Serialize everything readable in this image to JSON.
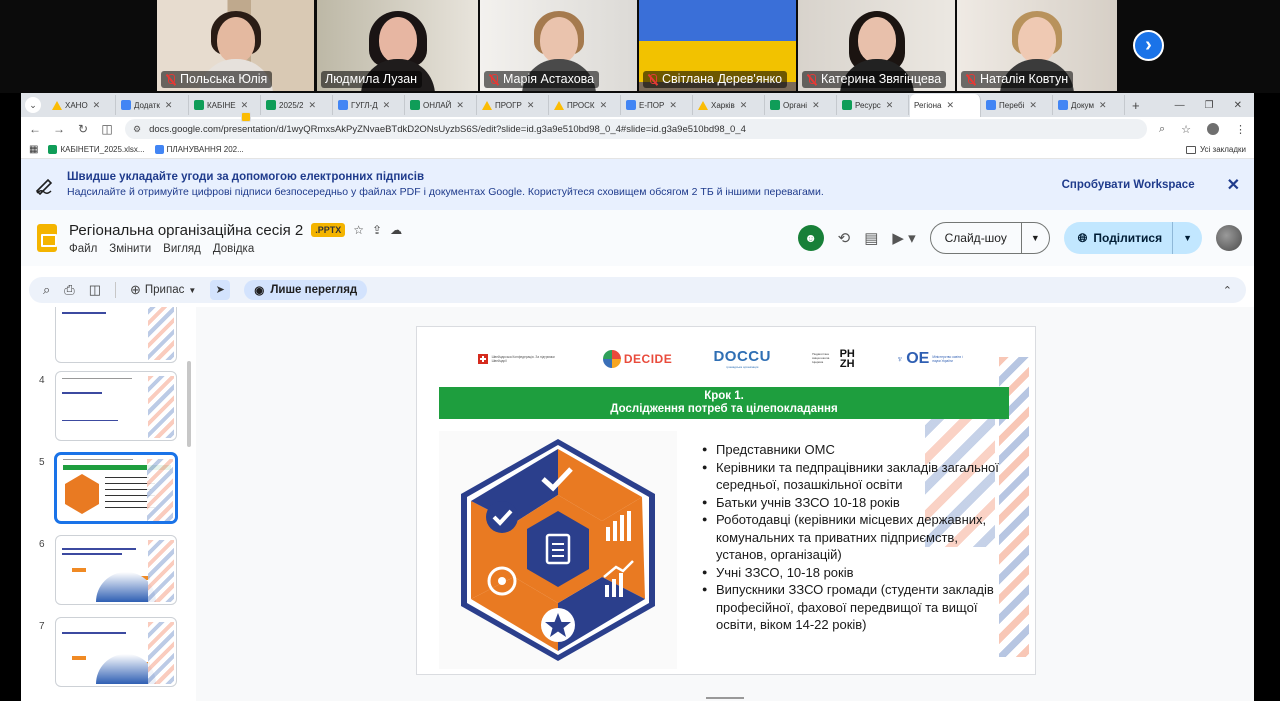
{
  "conference": {
    "participants": [
      {
        "name": "Польська Юлія",
        "muted": true
      },
      {
        "name": "Людмила Лузан",
        "muted": false
      },
      {
        "name": "Марія Астахова",
        "muted": true
      },
      {
        "name": "Світлана Дерев'янко",
        "muted": true
      },
      {
        "name": "Катерина Звягінцева",
        "muted": true
      },
      {
        "name": "Наталія Ковтун",
        "muted": true
      }
    ],
    "next_icon": "chevron-right-icon"
  },
  "browser": {
    "tabs": [
      {
        "label": "ХАНО",
        "icon": "drive"
      },
      {
        "label": "Додатк",
        "icon": "doc"
      },
      {
        "label": "КАБІНЕ",
        "icon": "sheet"
      },
      {
        "label": "2025/2",
        "icon": "sheet"
      },
      {
        "label": "ГУГЛ-Д",
        "icon": "doc"
      },
      {
        "label": "ОНЛАЙ",
        "icon": "sheet"
      },
      {
        "label": "ПРОГР",
        "icon": "drive"
      },
      {
        "label": "ПРОСК",
        "icon": "drive"
      },
      {
        "label": "Е-ПОР",
        "icon": "doc"
      },
      {
        "label": "Харків",
        "icon": "drive"
      },
      {
        "label": "Органі",
        "icon": "sheet"
      },
      {
        "label": "Ресурс",
        "icon": "sheet"
      },
      {
        "label": "Регіона",
        "icon": "slide",
        "active": true
      },
      {
        "label": "Перебі",
        "icon": "doc"
      },
      {
        "label": "Докум",
        "icon": "doc"
      }
    ],
    "url": "docs.google.com/presentation/d/1wyQRmxsAkPyZNvaeBTdkD2ONsUyzbS6S/edit?slide=id.g3a9e510bd98_0_4#slide=id.g3a9e510bd98_0_4",
    "bookmarks": [
      {
        "label": "КАБІНЕТИ_2025.xlsx...",
        "icon": "sheet"
      },
      {
        "label": "ПЛАНУВАННЯ 202...",
        "icon": "doc"
      }
    ],
    "all_bookmarks": "Усі закладки"
  },
  "banner": {
    "title": "Швидше укладайте угоди за допомогою електронних підписів",
    "subtitle": "Надсилайте й отримуйте цифрові підписи безпосередньо у файлах PDF і документах Google. Користуйтеся сховищем обсягом 2 ТБ й іншими перевагами.",
    "cta": "Спробувати Workspace"
  },
  "doc": {
    "title": "Регіональна організаційна сесія 2",
    "badge": ".PPTX",
    "menu": [
      "Файл",
      "Змінити",
      "Вигляд",
      "Довідка"
    ],
    "slideshow_label": "Слайд-шоу",
    "share_label": "Поділитися"
  },
  "toolbar": {
    "zoom_label": "Припас",
    "view_only_label": "Лише перегляд"
  },
  "filmstrip": {
    "slides": [
      {
        "num": "",
        "caption": "Процес нової спільноті",
        "selected": false
      },
      {
        "num": "4",
        "caption": "Організація процесу",
        "selected": false
      },
      {
        "num": "5",
        "caption": "Крок 1",
        "selected": true
      },
      {
        "num": "6",
        "caption": "Як вивчити потреби громади",
        "selected": false
      },
      {
        "num": "7",
        "caption": "Підсумки",
        "selected": false
      }
    ]
  },
  "slide": {
    "logos": {
      "swiss": "Швейцарська Конфедерація. За підтримки Швейцарії",
      "decide": "DECIDE",
      "doccu": "DOCCU",
      "doccu_sub": "громадська організація",
      "phzh_text": "Педагогічна вища школа Цюриха",
      "phzh": "PH ZH",
      "mon_mark": "ОЕ",
      "mon": "Міністерство освіти і науки України"
    },
    "step_title": "Крок 1.",
    "step_subtitle": "Дослідження потреб  та цілепокладання",
    "bullets": [
      "Представники ОМС",
      "Керівники та педпрацівники закладів загальної середньої, позашкільної освіти",
      "Батьки учнів ЗЗСО 10-18 років",
      "Роботодавці (керівники місцевих державних, комунальних та приватних підприємств, установ, організацій)",
      "Учні ЗЗСО, 10-18 років",
      "Випускники ЗЗСО громади (студенти закладів професійної, фахової передвищої та вищої освіти, віком 14-22 років)"
    ],
    "colors": {
      "green": "#1e9e3e",
      "orange": "#e97a22",
      "navy": "#2b3f8c"
    }
  }
}
